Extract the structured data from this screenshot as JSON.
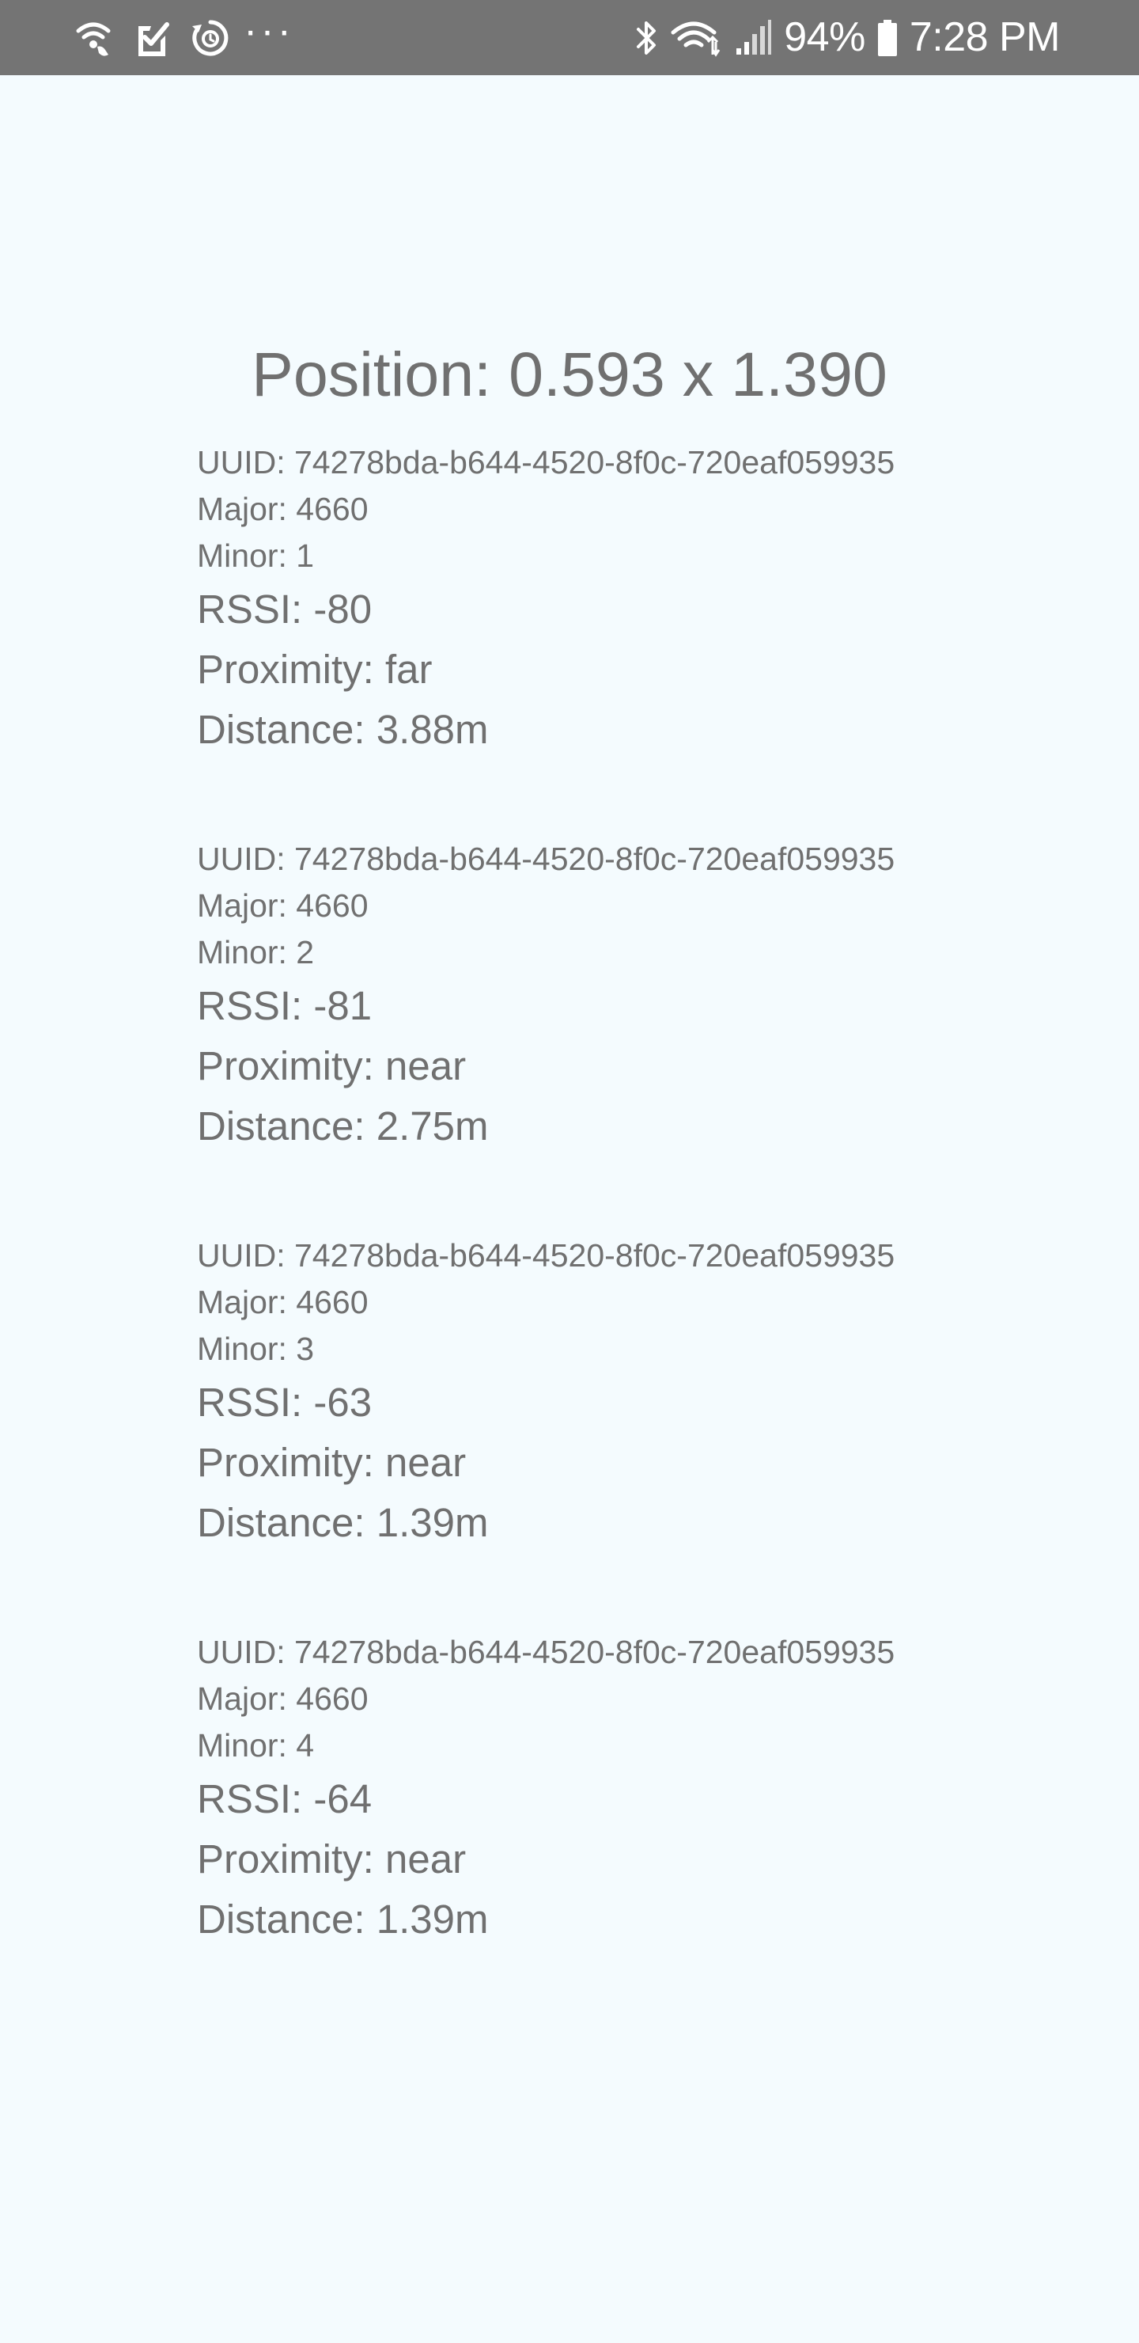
{
  "status_bar": {
    "battery_percent": "94%",
    "time": "7:28 PM",
    "more_indicator": "···",
    "left_icons": [
      "wifi-call-icon",
      "clipboard-check-icon",
      "sync-clock-icon",
      "more-icon"
    ],
    "right_icons": [
      "bluetooth-icon",
      "wifi-icon",
      "signal-icon",
      "battery-icon"
    ]
  },
  "position": {
    "text": "Position: 0.593 x 1.390"
  },
  "beacons": [
    {
      "uuid": "UUID: 74278bda-b644-4520-8f0c-720eaf059935",
      "major": "Major: 4660",
      "minor": "Minor: 1",
      "rssi": "RSSI: -80",
      "proximity": "Proximity: far",
      "distance": "Distance: 3.88m"
    },
    {
      "uuid": "UUID: 74278bda-b644-4520-8f0c-720eaf059935",
      "major": "Major: 4660",
      "minor": "Minor: 2",
      "rssi": "RSSI: -81",
      "proximity": "Proximity: near",
      "distance": "Distance: 2.75m"
    },
    {
      "uuid": "UUID: 74278bda-b644-4520-8f0c-720eaf059935",
      "major": "Major: 4660",
      "minor": "Minor: 3",
      "rssi": "RSSI: -63",
      "proximity": "Proximity: near",
      "distance": "Distance: 1.39m"
    },
    {
      "uuid": "UUID: 74278bda-b644-4520-8f0c-720eaf059935",
      "major": "Major: 4660",
      "minor": "Minor: 4",
      "rssi": "RSSI: -64",
      "proximity": "Proximity: near",
      "distance": "Distance: 1.39m"
    }
  ],
  "colors": {
    "background": "#f4fbfe",
    "status_bar": "#747474",
    "text": "#707070"
  }
}
